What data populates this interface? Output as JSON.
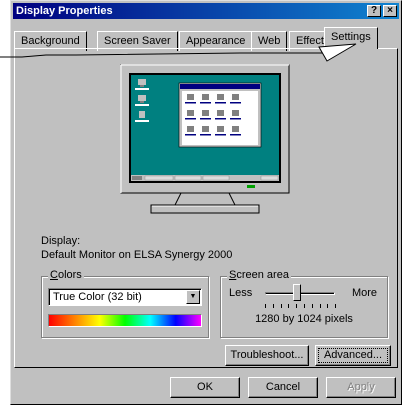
{
  "window": {
    "title": "Display Properties",
    "help_glyph": "?",
    "close_glyph": "×"
  },
  "tabs": [
    {
      "label": "Background"
    },
    {
      "label": "Screen Saver"
    },
    {
      "label": "Appearance"
    },
    {
      "label": "Web"
    },
    {
      "label": "Effects"
    },
    {
      "label": "Settings"
    }
  ],
  "active_tab": "Settings",
  "preview": {
    "desktop_color": "#008080",
    "icons": [
      "My Computer",
      "Network Neighborhood",
      "Recycle Bin"
    ]
  },
  "display": {
    "label": "Display:",
    "value": "Default Monitor on ELSA Synergy 2000"
  },
  "colors": {
    "group_label": "Colors",
    "selected": "True Color (32 bit)",
    "arrow_glyph": "▼",
    "spectrum": [
      "#ff0000",
      "#ff8000",
      "#ffff00",
      "#00ff00",
      "#00ffff",
      "#0000ff",
      "#ff00ff"
    ]
  },
  "screen_area": {
    "group_label": "Screen area",
    "less_label": "Less",
    "more_label": "More",
    "value": "1280 by 1024 pixels",
    "slider_fraction": 0.45
  },
  "buttons": {
    "troubleshoot": "Troubleshoot...",
    "advanced": "Advanced...",
    "ok": "OK",
    "cancel": "Cancel",
    "apply": "Apply"
  },
  "theme": {
    "face": "#c0c0c0",
    "title_start": "#000080",
    "title_end": "#1084d0"
  }
}
